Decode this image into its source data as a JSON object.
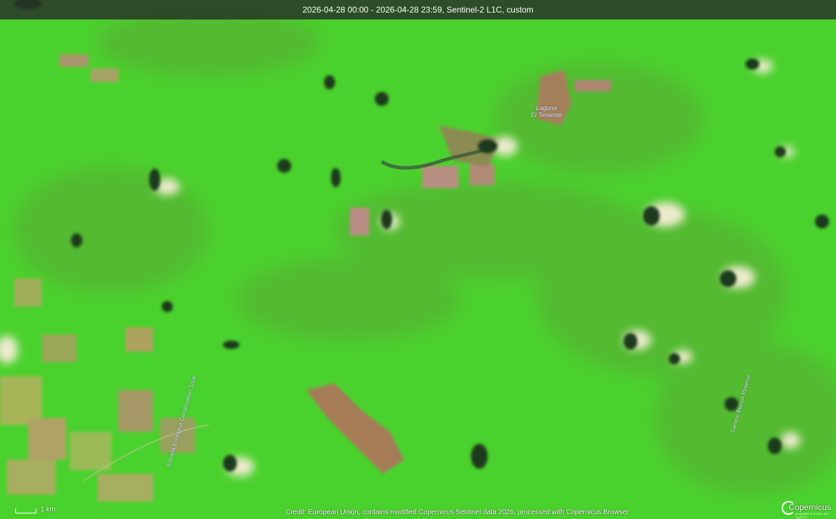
{
  "header": {
    "title": "2026-04-28 00:00 - 2026-04-28 23:59, Sentinel-2 L1C, custom"
  },
  "map": {
    "labels": {
      "lake_line1": "Laguna",
      "lake_line2": "El Teniente",
      "road_west": "Entrada Ecologica Conservation Zone",
      "road_east": "Camino Blanco Reserve"
    },
    "colors": {
      "vegetation": "#4bd12e",
      "vegetation_dark": "#3fae2a",
      "cleared_land": "#b58a6a",
      "cloud": "#e8e6d0",
      "shadow": "#1f3a1a"
    }
  },
  "footer": {
    "scale_label": "1 km",
    "credit": "Credit: European Union, contains modified Copernicus Sentinel data 2026, processed with Copernicus Browser",
    "logo_text": "Copernicus",
    "logo_subtext": "EUROPE'S EYES ON EARTH"
  }
}
